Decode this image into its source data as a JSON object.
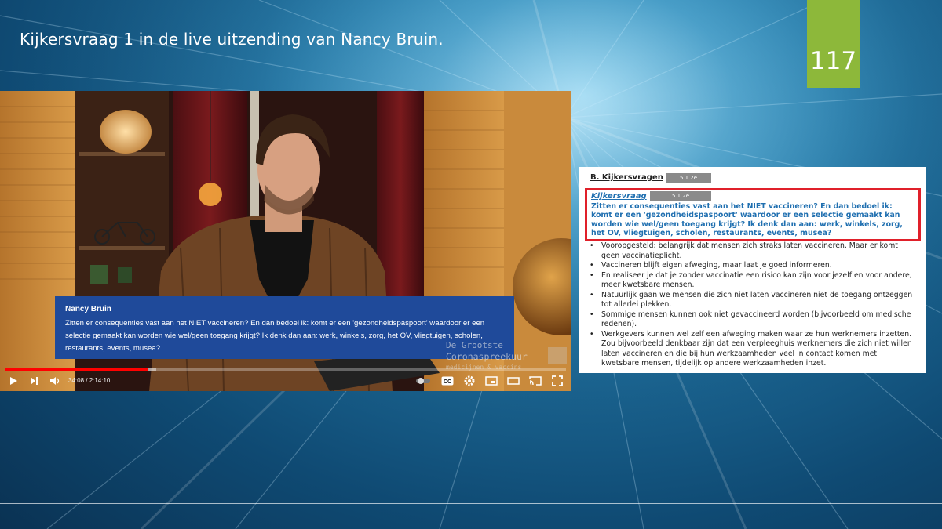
{
  "slide": {
    "title": "Kijkersvraag 1 in de live uitzending van Nancy Bruin.",
    "page_number": "117",
    "accent_color": "#8db83a"
  },
  "video": {
    "caption": {
      "name": "Nancy Bruin",
      "text": "Zitten er consequenties vast aan het NIET vaccineren? En dan bedoel ik: komt er een 'gezondheidspaspoort' waardoor er een selectie gemaakt kan worden wie wel/geen toegang krijgt? Ik denk dan aan: werk, winkels, zorg, het OV, vliegtuigen, scholen, restaurants, events, musea?"
    },
    "watermark": {
      "line1": "De Grootste",
      "line2": "Coronaspreekuur",
      "line3": "medicijnen & vaccins"
    },
    "player": {
      "time_display": "34:08 / 2:14:10",
      "progress_fraction": 0.254,
      "buffered_fraction": 0.27,
      "progress_color": "#ff0000",
      "icons": [
        "play-icon",
        "next-icon",
        "volume-icon",
        "autoplay-toggle",
        "subtitles-icon",
        "settings-icon",
        "miniplayer-icon",
        "theater-icon",
        "cast-icon",
        "fullscreen-icon"
      ],
      "subtitles_label": "CC"
    }
  },
  "document": {
    "heading": "B. Kijkersvragen",
    "redaction_code": "5.1.2e",
    "question_label": "Kijkersvraag",
    "question_text": "Zitten er consequenties vast aan het NIET vaccineren? En dan bedoel ik: komt er een 'gezondheidspaspoort' waardoor er een selectie gemaakt kan worden wie wel/geen toegang krijgt? Ik denk dan aan: werk, winkels, zorg, het OV, vliegtuigen, scholen, restaurants, events, musea?",
    "question_color": "#1f6fb0",
    "highlight_color": "#e0202a",
    "answers": [
      "Vooropgesteld: belangrijk dat mensen zich straks laten vaccineren. Maar er komt geen vaccinatieplicht.",
      "Vaccineren blijft eigen afweging, maar laat je goed informeren.",
      "En realiseer je dat je zonder vaccinatie een risico kan zijn voor jezelf en voor andere, meer kwetsbare mensen.",
      "Natuurlijk gaan we mensen die zich niet laten vaccineren niet de toegang ontzeggen tot allerlei plekken.",
      "Sommige mensen kunnen ook niet gevaccineerd worden (bijvoorbeeld om medische redenen).",
      "Werkgevers kunnen wel zelf een afweging maken waar ze hun werknemers inzetten. Zou bijvoorbeeld denkbaar zijn dat een verpleeghuis werknemers die zich niet willen laten vaccineren en die bij hun werkzaamheden veel in contact komen met kwetsbare mensen, tijdelijk op andere werkzaamheden inzet."
    ]
  }
}
